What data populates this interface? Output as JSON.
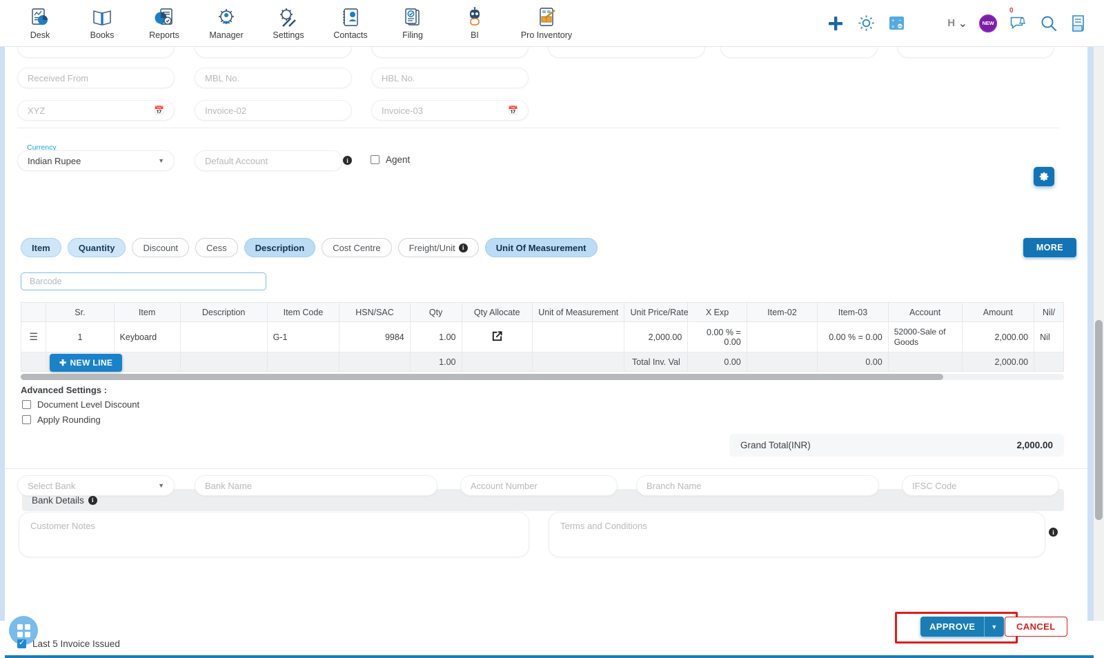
{
  "topnav": {
    "items": [
      {
        "label": "Desk",
        "icon": "desk-chart-icon"
      },
      {
        "label": "Books",
        "icon": "book-icon"
      },
      {
        "label": "Reports",
        "icon": "reports-pie-icon"
      },
      {
        "label": "Manager",
        "icon": "manager-gear-people-icon"
      },
      {
        "label": "Settings",
        "icon": "settings-gear-wrench-icon"
      },
      {
        "label": "Contacts",
        "icon": "contacts-card-icon"
      },
      {
        "label": "Filing",
        "icon": "filing-document-icon"
      },
      {
        "label": "BI",
        "icon": "bi-robot-icon"
      },
      {
        "label": "Pro Inventory",
        "icon": "pro-inventory-box-icon"
      }
    ],
    "right": {
      "add_icon": "plus-icon",
      "settings_icon": "gear-icon",
      "calculator_icon": "calculator-icon",
      "user_initial": "H",
      "chevron_icon": "chevron-down-icon",
      "new_badge": "NEW",
      "chat_count": "0",
      "chat_icon": "chat-bell-icon",
      "search_icon": "search-icon",
      "notes_icon": "notes-document-icon"
    }
  },
  "form": {
    "row_received": [
      {
        "placeholder": "Received From",
        "name": "received-from"
      },
      {
        "placeholder": "MBL No.",
        "name": "mbl-no"
      },
      {
        "placeholder": "HBL No.",
        "name": "hbl-no"
      }
    ],
    "row_invoice": [
      {
        "placeholder": "XYZ",
        "name": "xyz-date",
        "icon": "calendar-icon"
      },
      {
        "placeholder": "Invoice-02",
        "name": "invoice-02"
      },
      {
        "placeholder": "Invoice-03",
        "name": "invoice-03",
        "icon": "calendar-icon"
      }
    ],
    "currency": {
      "label": "Currency",
      "value": "Indian Rupee"
    },
    "default_account": {
      "placeholder": "Default Account"
    },
    "agent": {
      "label": "Agent",
      "checked": false
    }
  },
  "chips": [
    {
      "label": "Item",
      "state": "selected"
    },
    {
      "label": "Quantity",
      "state": "selected"
    },
    {
      "label": "Discount",
      "state": "default"
    },
    {
      "label": "Cess",
      "state": "default"
    },
    {
      "label": "Description",
      "state": "selected-strong"
    },
    {
      "label": "Cost Centre",
      "state": "default"
    },
    {
      "label": "Freight/Unit",
      "state": "default",
      "info": true
    },
    {
      "label": "Unit Of Measurement",
      "state": "selected-strong"
    }
  ],
  "more_button": "MORE",
  "gear_button_icon": "gear-icon",
  "barcode": {
    "placeholder": "Barcode"
  },
  "table": {
    "columns": [
      "",
      "Sr.",
      "Item",
      "Description",
      "Item Code",
      "HSN/SAC",
      "Qty",
      "Qty Allocate",
      "Unit of Measurement",
      "Unit Price/Rate",
      "X Exp",
      "Item-02",
      "Item-03",
      "Account",
      "Amount",
      "Nil/"
    ],
    "rows": [
      {
        "sr": "1",
        "item": "Keyboard",
        "description": "",
        "item_code": "G-1",
        "hsn_sac": "9984",
        "qty": "1.00",
        "qty_allocate_icon": "external-link-icon",
        "uom": "",
        "unit_price": "2,000.00",
        "x_exp": "0.00 % = 0.00",
        "item_02": "",
        "item_03": "0.00 % = 0.00",
        "account": "52000-Sale of Goods",
        "amount": "2,000.00",
        "nil": "Nil"
      }
    ],
    "totals": {
      "qty": "1.00",
      "label": "Total Inv. Val",
      "x_exp": "0.00",
      "item_03": "0.00",
      "amount": "2,000.00"
    },
    "new_line_button": "NEW LINE"
  },
  "advanced": {
    "title": "Advanced Settings :",
    "options": [
      {
        "label": "Document Level Discount",
        "checked": false
      },
      {
        "label": "Apply Rounding",
        "checked": false
      }
    ]
  },
  "grand_total": {
    "label": "Grand Total(INR)",
    "value": "2,000.00"
  },
  "bank": {
    "header": "Bank Details",
    "select_bank": "Select Bank",
    "fields": [
      {
        "placeholder": "Bank Name",
        "name": "bank-name"
      },
      {
        "placeholder": "Account Number",
        "name": "account-number"
      },
      {
        "placeholder": "Branch Name",
        "name": "branch-name"
      },
      {
        "placeholder": "IFSC Code",
        "name": "ifsc-code"
      }
    ]
  },
  "notes": {
    "customer_notes_placeholder": "Customer Notes",
    "terms_placeholder": "Terms and Conditions"
  },
  "actions": {
    "approve": "APPROVE",
    "cancel": "CANCEL"
  },
  "footer": {
    "last5_label": "Last 5 Invoice Issued",
    "last5_checked": true,
    "fab_icon": "grid-apps-icon"
  },
  "colors": {
    "primary": "#1473b5",
    "highlight": "#e01b1b",
    "chip_selected": "#cfe6f8",
    "accent_cyan": "#13a7e0"
  }
}
